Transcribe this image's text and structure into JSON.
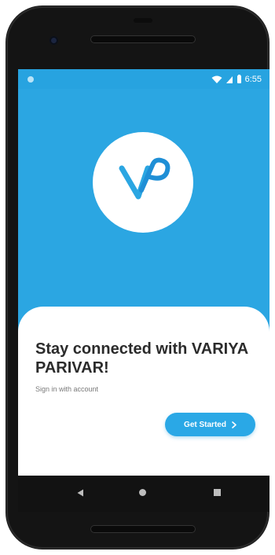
{
  "status_bar": {
    "time": "6:55",
    "icons": [
      "wifi-icon",
      "signal-icon",
      "battery-icon"
    ]
  },
  "logo": {
    "text": "VP",
    "color": "#2ba6e2"
  },
  "card": {
    "title": "Stay connected with VARIYA PARIVAR!",
    "subtitle": "Sign in with account",
    "cta_label": "Get Started",
    "cta_icon": "chevron-right-icon"
  },
  "nav_bar": {
    "buttons": [
      "back-icon",
      "home-icon",
      "recents-icon"
    ]
  },
  "colors": {
    "primary": "#2ba6e2",
    "card_bg": "#ffffff",
    "title": "#2b2b2b"
  }
}
